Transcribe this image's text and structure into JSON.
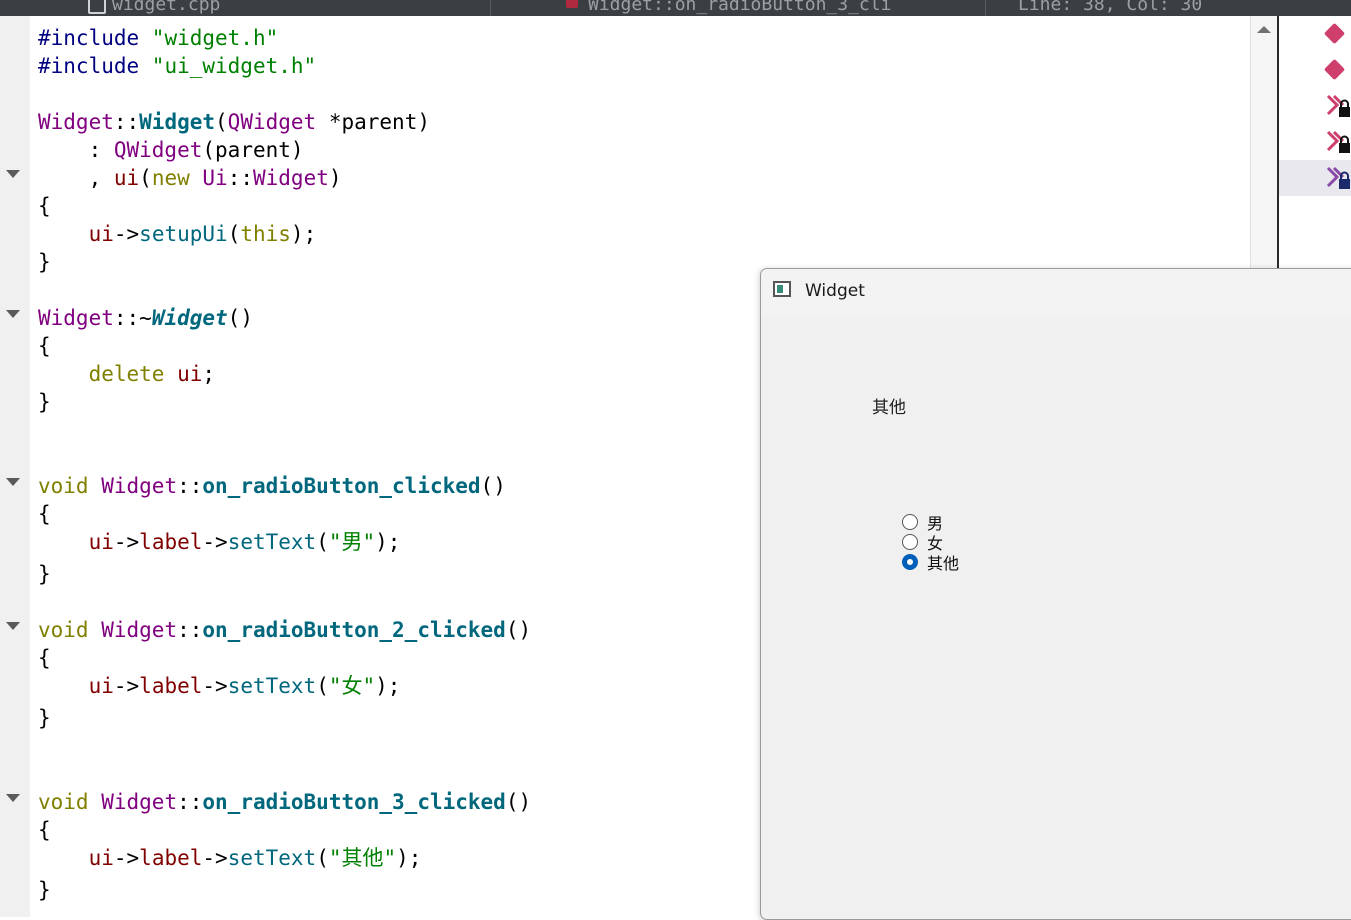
{
  "top_bar": {
    "file_tab": "widget.cpp",
    "func_tab": "Widget::on_radioButton_3_cli",
    "position": "Line: 38, Col: 30"
  },
  "editor": {
    "lines": [
      [
        "#include \"widget.h\""
      ],
      [
        "#include \"ui_widget.h\""
      ],
      [
        "Widget::Widget(QWidget *parent)"
      ],
      [
        "    : QWidget(parent)"
      ],
      [
        "    , ui(new Ui::Widget)"
      ],
      [
        "{"
      ],
      [
        "    ui->setupUi(this);"
      ],
      [
        "}"
      ],
      [
        "Widget::~Widget()"
      ],
      [
        "{"
      ],
      [
        "    delete ui;"
      ],
      [
        "}"
      ],
      [
        "void Widget::on_radioButton_clicked()"
      ],
      [
        "{"
      ],
      [
        "    ui->label->setText(\"男\");"
      ],
      [
        "}"
      ],
      [
        "void Widget::on_radioButton_2_clicked()"
      ],
      [
        "{"
      ],
      [
        "    ui->label->setText(\"女\");"
      ],
      [
        "}"
      ],
      [
        "void Widget::on_radioButton_3_clicked()"
      ],
      [
        "{"
      ],
      [
        "    ui->label->setText(\"其他\");"
      ],
      [
        "}"
      ]
    ]
  },
  "widget_window": {
    "title": "Widget",
    "label_text": "其他",
    "radio_buttons": [
      {
        "label": "男",
        "checked": false
      },
      {
        "label": "女",
        "checked": false
      },
      {
        "label": "其他",
        "checked": true
      }
    ]
  },
  "colors": {
    "keyword": "#808000",
    "type": "#800080",
    "function": "#00677c",
    "string": "#008000",
    "radio_checked": "#005fb8"
  }
}
